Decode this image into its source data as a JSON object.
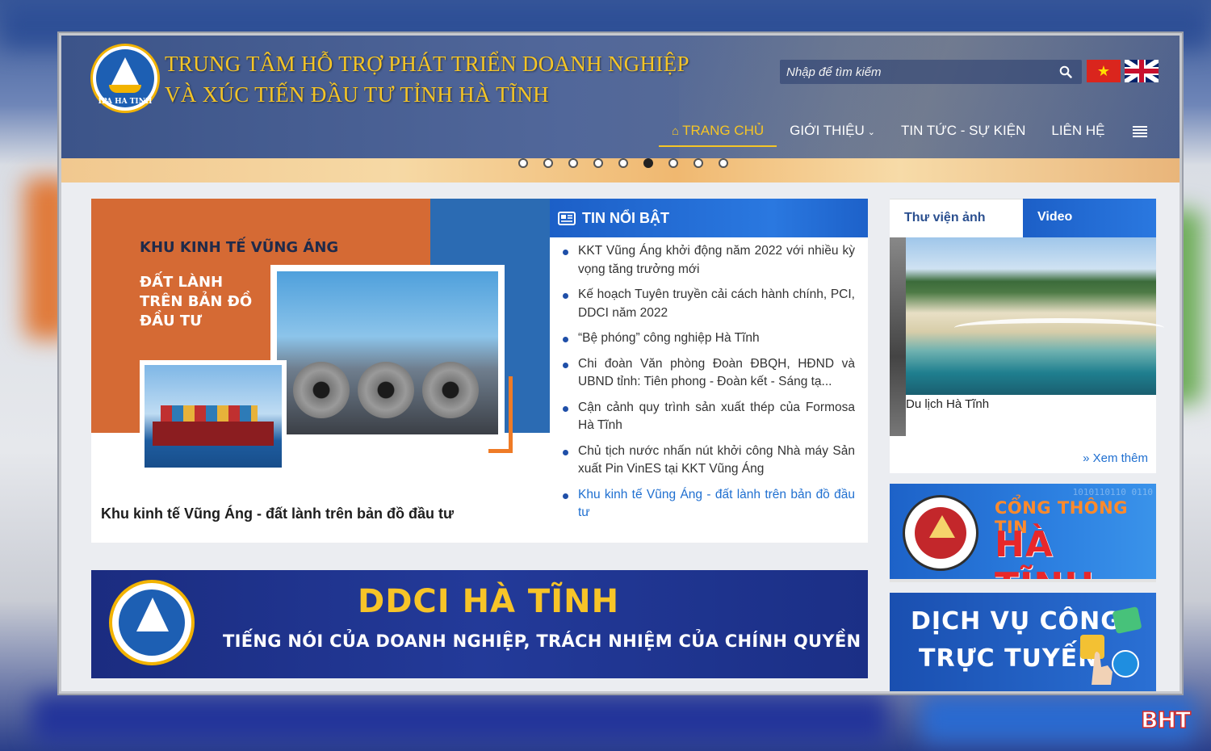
{
  "header": {
    "title_line1": "TRUNG TÂM HỖ TRỢ PHÁT TRIỂN DOANH NGHIỆP",
    "title_line2": "VÀ XÚC TIẾN ĐẦU TƯ TỈNH HÀ TĨNH",
    "logo_text": "IPA HA TINH",
    "search_placeholder": "Nhập để tìm kiếm"
  },
  "nav": {
    "items": [
      {
        "label": "TRANG CHỦ",
        "active": true
      },
      {
        "label": "GIỚI THIỆU",
        "has_dropdown": true
      },
      {
        "label": "TIN TỨC - SỰ KIỆN"
      },
      {
        "label": "LIÊN HỆ"
      }
    ]
  },
  "slider": {
    "dot_count": 9,
    "active_index": 5
  },
  "featured": {
    "image_heading": "KHU KINH TẾ VŨNG ÁNG",
    "image_subheading": [
      "ĐẤT LÀNH",
      "TRÊN BẢN ĐỒ",
      "ĐẦU TƯ"
    ],
    "caption": "Khu kinh tế Vũng Áng - đất lành trên bản đồ đầu tư"
  },
  "hot_news": {
    "title": "TIN NỔI BẬT",
    "items": [
      {
        "text": "KKT Vũng Áng khởi động năm 2022 với nhiều kỳ vọng tăng trưởng mới"
      },
      {
        "text": "Kế hoạch Tuyên truyền cải cách hành chính, PCI, DDCI năm 2022"
      },
      {
        "text": "“Bệ phóng” công nghiệp Hà Tĩnh"
      },
      {
        "text": "Chi đoàn Văn phòng Đoàn ĐBQH, HĐND và UBND tỉnh: Tiên phong - Đoàn kết - Sáng tạ..."
      },
      {
        "text": "Cận cảnh quy trình sản xuất thép của Formosa Hà Tĩnh"
      },
      {
        "text": "Chủ tịch nước nhấn nút khởi công Nhà máy Sản xuất Pin VinES tại KKT Vũng Áng"
      },
      {
        "text": "Khu kinh tế Vũng Áng - đất lành trên bản đồ đầu tư",
        "active": true
      }
    ]
  },
  "library": {
    "tab_photos": "Thư viện ảnh",
    "tab_video": "Video",
    "photo_caption": "Du lịch Hà Tĩnh",
    "more": "» Xem thêm"
  },
  "portal_banner": {
    "line1": "CỔNG THÔNG TIN",
    "line2": "HÀ TĨNH",
    "bits": "1010110110\n0110"
  },
  "service_banner": {
    "line1": "DỊCH VỤ CÔNG",
    "line2": "TRỰC TUYẾN"
  },
  "ddci_banner": {
    "title": "DDCI HÀ TĨNH",
    "subtitle": "TIẾNG NÓI CỦA DOANH NGHIỆP, TRÁCH NHIỆM CỦA CHÍNH QUYỀN"
  },
  "watermark": "BHT",
  "colors": {
    "gold": "#f5c526",
    "blue": "#1c5fc7",
    "link": "#1f6fd0",
    "red": "#e8272a"
  }
}
